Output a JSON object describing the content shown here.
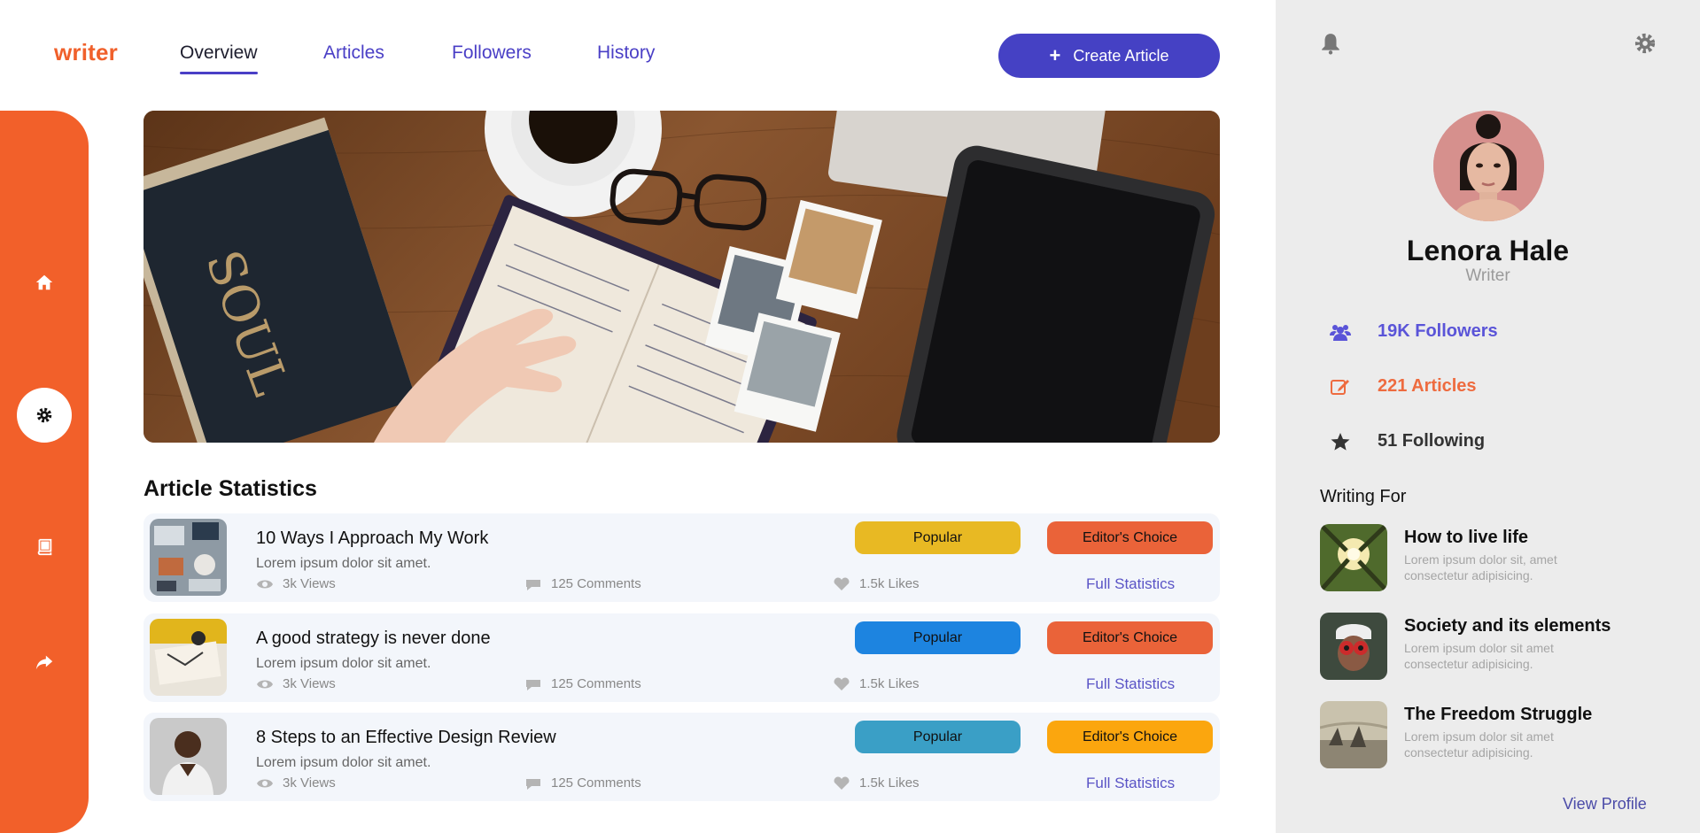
{
  "brand": {
    "logo_text": "writer"
  },
  "nav": {
    "tabs": [
      {
        "label": "Overview",
        "active": true
      },
      {
        "label": "Articles",
        "active": false
      },
      {
        "label": "Followers",
        "active": false
      },
      {
        "label": "History",
        "active": false
      }
    ],
    "create_label": "Create Article"
  },
  "rail": {
    "items": [
      "home-icon",
      "gear-icon",
      "book-icon",
      "share-icon"
    ],
    "active_index": 1
  },
  "statistics": {
    "title": "Article Statistics",
    "rows": [
      {
        "title": "10 Ways I Approach My Work",
        "subtitle": "Lorem ipsum dolor sit amet.",
        "views": "3k Views",
        "comments": "125 Comments",
        "likes": "1.5k Likes",
        "tag1": "Popular",
        "tag1_color": "#e8b923",
        "tag2": "Editor's Choice",
        "tag2_color": "#ea6339",
        "link": "Full Statistics"
      },
      {
        "title": "A good strategy is never done",
        "subtitle": "Lorem ipsum dolor sit amet.",
        "views": "3k Views",
        "comments": "125 Comments",
        "likes": "1.5k Likes",
        "tag1": "Popular",
        "tag1_color": "#1d84e0",
        "tag2": "Editor's Choice",
        "tag2_color": "#ea6339",
        "link": "Full Statistics"
      },
      {
        "title": "8 Steps to an Effective Design Review",
        "subtitle": "Lorem ipsum dolor sit amet.",
        "views": "3k Views",
        "comments": "125 Comments",
        "likes": "1.5k Likes",
        "tag1": "Popular",
        "tag1_color": "#3a9fc6",
        "tag2": "Editor's Choice",
        "tag2_color": "#fba60e",
        "link": "Full Statistics"
      }
    ]
  },
  "profile": {
    "name": "Lenora Hale",
    "role": "Writer",
    "followers": "19K Followers",
    "followers_color": "#5a54d8",
    "articles": "221 Articles",
    "articles_color": "#ee6b3f",
    "following": "51 Following",
    "following_color": "#333333",
    "writing_for_label": "Writing For",
    "publications": [
      {
        "title": "How to live life",
        "desc": "Lorem ipsum dolor sit, amet consectetur adipisicing."
      },
      {
        "title": "Society and its elements",
        "desc": "Lorem ipsum dolor sit amet consectetur adipisicing."
      },
      {
        "title": "The Freedom Struggle",
        "desc": "Lorem ipsum dolor sit amet consectetur adipisicing."
      }
    ],
    "view_profile_label": "View Profile"
  },
  "colors": {
    "accent": "#4541c4",
    "brand_orange": "#f2602a",
    "panel_bg": "#ececec"
  }
}
